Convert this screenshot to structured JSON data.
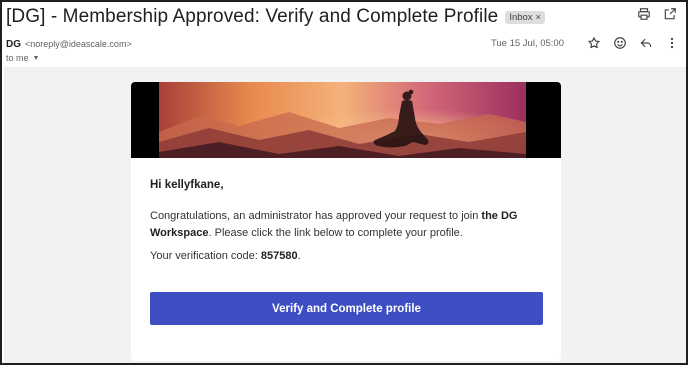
{
  "email": {
    "subject": "[DG] - Membership Approved: Verify and Complete Profile",
    "label": "Inbox",
    "sender_name": "DG",
    "sender_email": "<noreply@ideascale.com>",
    "date": "Tue 15 Jul, 05:00",
    "to": "to me"
  },
  "icons": {
    "print": "print-icon",
    "popout": "open-in-new-window-icon",
    "star": "star-icon",
    "emoji": "emoji-icon",
    "reply": "reply-icon",
    "more": "more-vert-icon"
  },
  "body": {
    "greeting": "Hi kellyfkane,",
    "para_1": "Congratulations, an administrator has approved your request to join ",
    "workspace": "the DG Workspace",
    "para_2": ". Please click the link below to complete your profile.",
    "code_label": "Your verification code: ",
    "code": "857580",
    "code_end": ".",
    "button": "Verify and Complete profile"
  },
  "colors": {
    "button": "#3d4ec2",
    "canvas": "#f2f2f2"
  }
}
